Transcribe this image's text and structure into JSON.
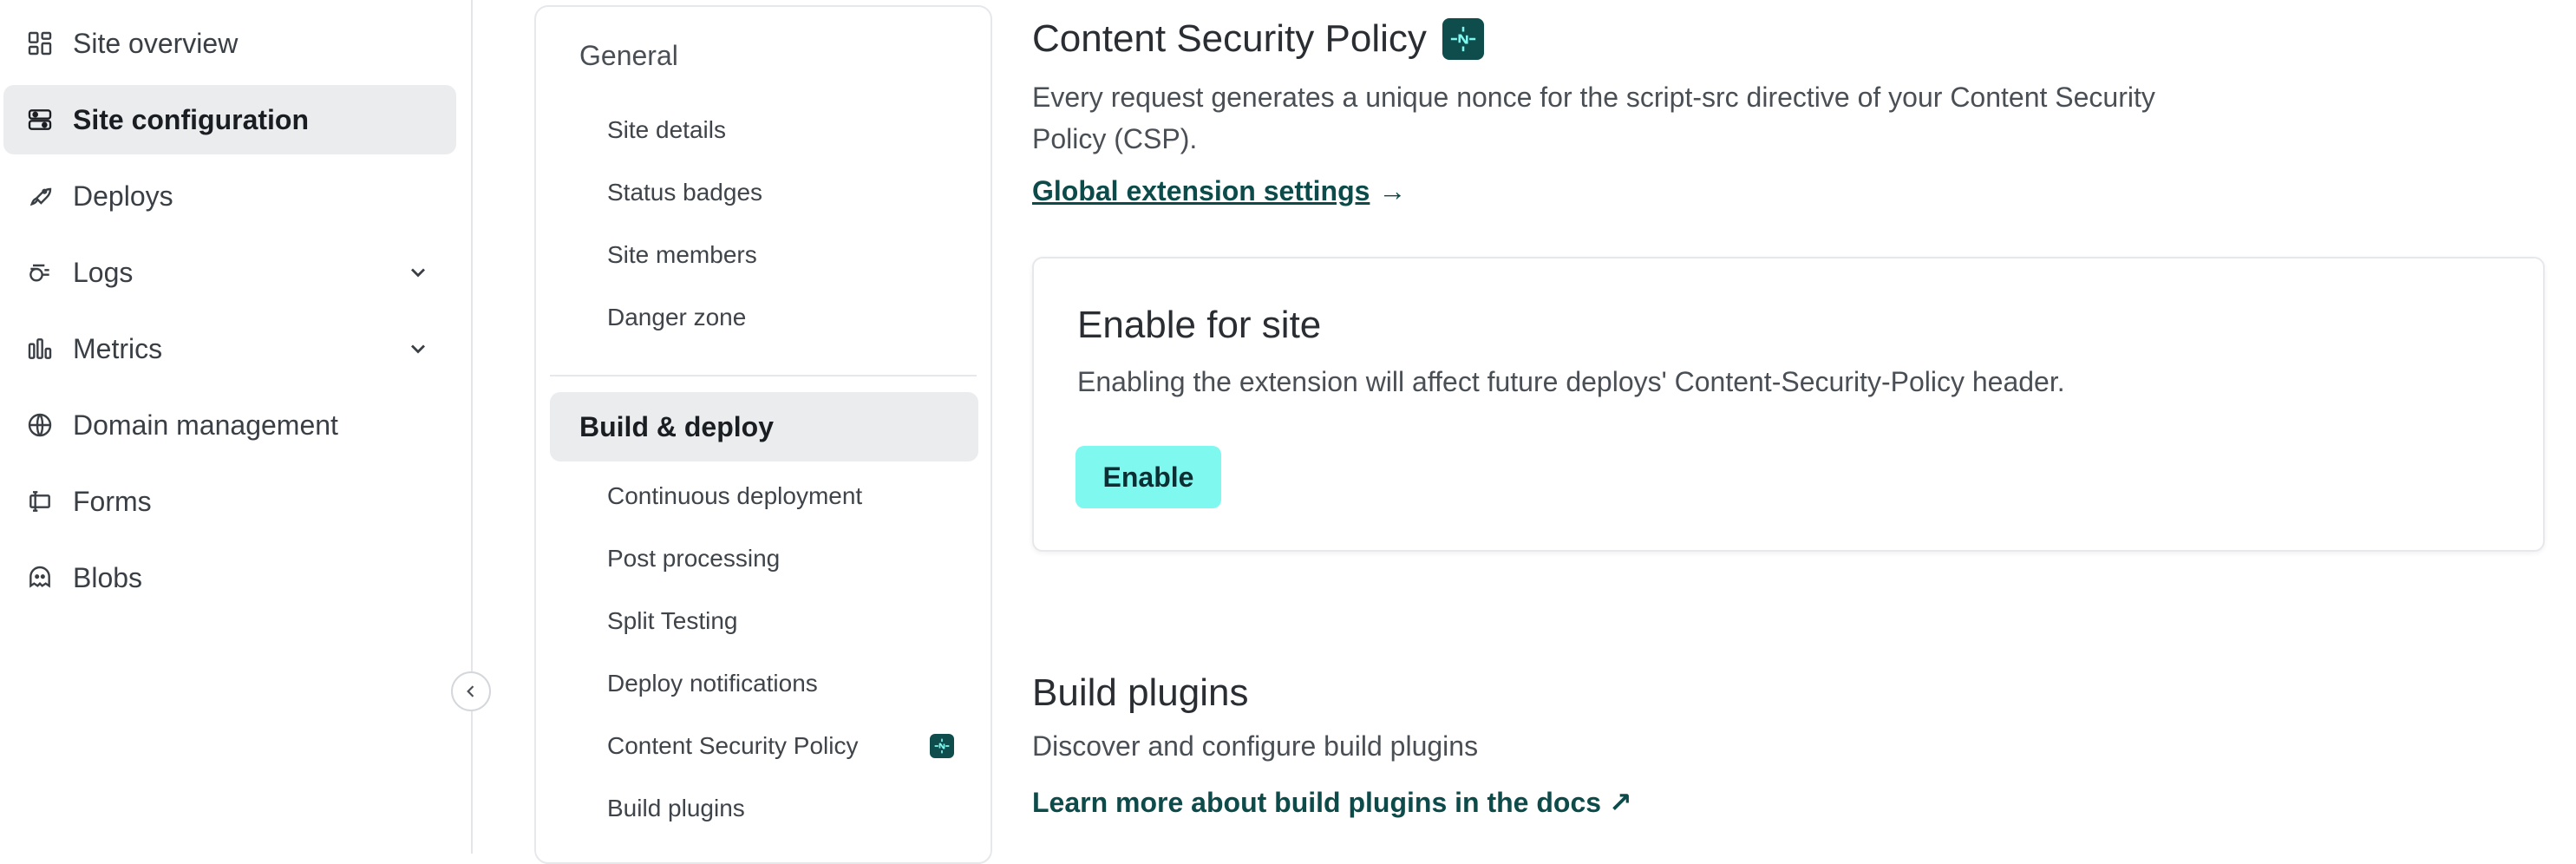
{
  "sidebar": {
    "items": [
      {
        "label": "Site overview",
        "icon": "dashboard-icon"
      },
      {
        "label": "Site configuration",
        "icon": "toggles-icon",
        "active": true
      },
      {
        "label": "Deploys",
        "icon": "rocket-icon"
      },
      {
        "label": "Logs",
        "icon": "logs-icon",
        "expandable": true
      },
      {
        "label": "Metrics",
        "icon": "bar-chart-icon",
        "expandable": true
      },
      {
        "label": "Domain management",
        "icon": "globe-icon"
      },
      {
        "label": "Forms",
        "icon": "form-icon"
      },
      {
        "label": "Blobs",
        "icon": "blob-icon"
      }
    ]
  },
  "settings_nav": {
    "general": {
      "title": "General",
      "items": [
        "Site details",
        "Status badges",
        "Site members",
        "Danger zone"
      ]
    },
    "build_deploy": {
      "title": "Build & deploy",
      "items": [
        "Continuous deployment",
        "Post processing",
        "Split Testing",
        "Deploy notifications",
        "Content Security Policy",
        "Build plugins"
      ]
    }
  },
  "main": {
    "title": "Content Security Policy",
    "description": "Every request generates a unique nonce for the script-src directive of your Content Security Policy (CSP).",
    "global_link": "Global extension settings",
    "link_arrow": "→",
    "card": {
      "title": "Enable for site",
      "text": "Enabling the extension will affect future deploys' Content-Security-Policy header.",
      "button": "Enable"
    },
    "build_plugins": {
      "title": "Build plugins",
      "description": "Discover and configure build plugins",
      "docs_link": "Learn more about build plugins in the docs",
      "docs_arrow": "↗"
    }
  },
  "colors": {
    "accent": "#0f4d4d",
    "enable_button": "#7ff8f0",
    "active_bg": "#ebecee"
  }
}
